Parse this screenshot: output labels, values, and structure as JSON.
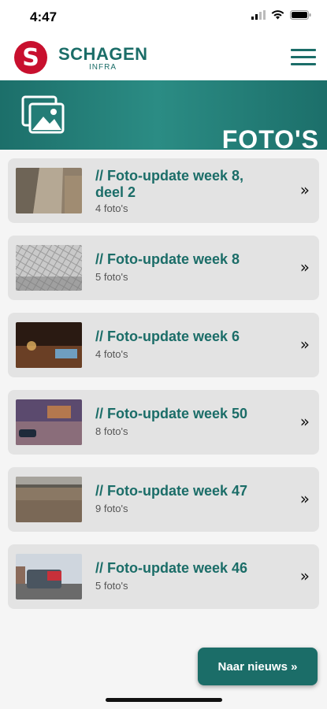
{
  "status": {
    "time": "4:47"
  },
  "header": {
    "logo_letter": "S",
    "brand": "SCHAGEN",
    "brand_sub": "INFRA"
  },
  "banner": {
    "title": "FOTO'S"
  },
  "albums": [
    {
      "title": "// Foto-update week 8, deel 2",
      "count": "4 foto's",
      "chevron": "»",
      "thumb": "brown-wall",
      "lines": 2
    },
    {
      "title": "// Foto-update week 8",
      "count": "5 foto's",
      "chevron": "»",
      "thumb": "paving",
      "lines": 1
    },
    {
      "title": "// Foto-update week 6",
      "count": "4 foto's",
      "chevron": "»",
      "thumb": "night-construction",
      "lines": 1
    },
    {
      "title": "// Foto-update week 50",
      "count": "8 foto's",
      "chevron": "»",
      "thumb": "street-evening",
      "lines": 1
    },
    {
      "title": "// Foto-update week 47",
      "count": "9 foto's",
      "chevron": "»",
      "thumb": "dirt-field",
      "lines": 1
    },
    {
      "title": "// Foto-update week 46",
      "count": "5 foto's",
      "chevron": "»",
      "thumb": "truck-road",
      "lines": 1
    }
  ],
  "fab": {
    "label": "Naar nieuws »"
  },
  "colors": {
    "brand": "#1b6d68",
    "logo": "#c8102e",
    "card": "#e3e3e3"
  }
}
